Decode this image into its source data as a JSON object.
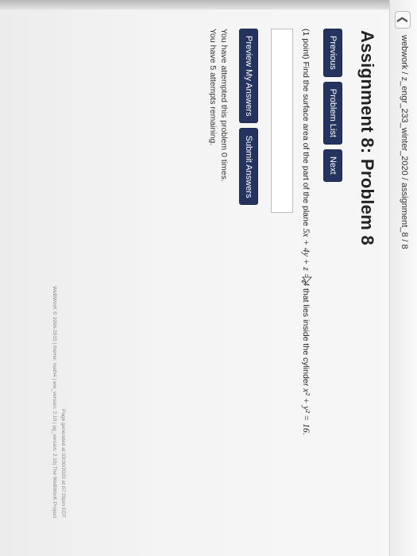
{
  "breadcrumb": "webwork / z_engr_233_winter_2020 / assignment_8 / 8",
  "page_title": "Assignment 8: Problem 8",
  "nav": {
    "previous": "Previous",
    "problem_list": "Problem List",
    "next": "Next"
  },
  "problem": {
    "points": "(1 point)",
    "text_1": " Find the surface area of the part of the plane ",
    "plane": "5x + 4y + z = 4",
    "text_2": " that lies inside the cylinder ",
    "cylinder": "x² + y² = 16",
    "text_3": "."
  },
  "answer": {
    "value": ""
  },
  "actions": {
    "preview": "Preview My Answers",
    "submit": "Submit Answers"
  },
  "status": {
    "attempts": "You have attempted this problem 0 times.",
    "remaining": "You have 5 attempts remaining."
  },
  "footer": {
    "generated": "Page generated at 03/30/2020 at 07:29pm EDT",
    "copyright": "WeBWorK © 1996-2015 | theme: math4 | ww_version: 2.10 | pg_version: 2.10| The WeBWorK Project"
  },
  "colors": {
    "button_bg": "#24345f",
    "button_text": "#ffffff"
  },
  "icons": {
    "back": "chevron-left-icon",
    "cursor": "mouse-pointer-icon"
  }
}
